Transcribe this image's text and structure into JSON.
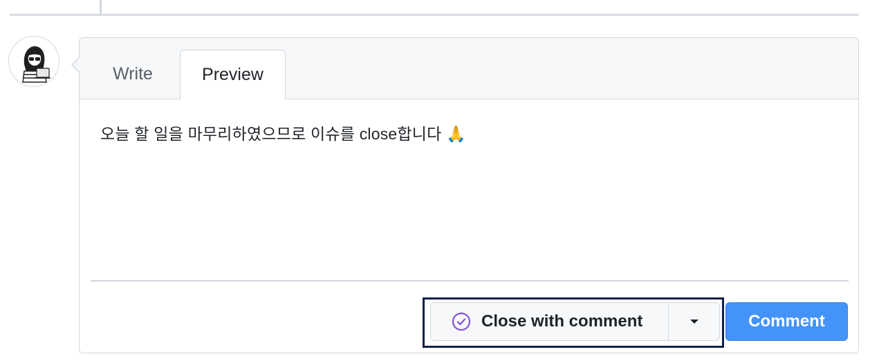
{
  "tabs": {
    "write": "Write",
    "preview": "Preview",
    "active": "Preview"
  },
  "preview": {
    "text": "오늘 할 일을 마무리하였으므로 이슈를 close합니다 🙏"
  },
  "actions": {
    "close_label": "Close with comment",
    "close_icon": "check-circle-icon",
    "dropdown_icon": "triangle-down-icon",
    "comment_label": "Comment"
  },
  "colors": {
    "accent": "#4493f8",
    "close_icon": "#8250df",
    "highlight": "#0d1f4a"
  }
}
